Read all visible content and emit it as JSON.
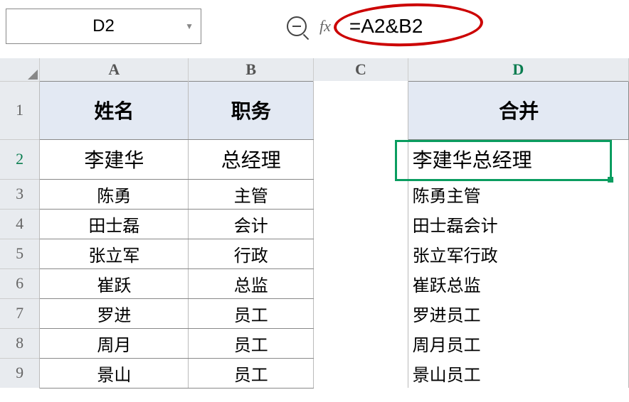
{
  "name_box": {
    "value": "D2"
  },
  "formula_bar": {
    "fx": "fx",
    "value": "=A2&B2"
  },
  "columns": [
    "A",
    "B",
    "C",
    "D"
  ],
  "headers": {
    "a": "姓名",
    "b": "职务",
    "c": "",
    "d": "合并"
  },
  "rows": [
    {
      "n": "1"
    },
    {
      "n": "2",
      "a": "李建华",
      "b": "总经理",
      "c": "",
      "d": "李建华总经理"
    },
    {
      "n": "3",
      "a": "陈勇",
      "b": "主管",
      "c": "",
      "d": "陈勇主管"
    },
    {
      "n": "4",
      "a": "田士磊",
      "b": "会计",
      "c": "",
      "d": "田士磊会计"
    },
    {
      "n": "5",
      "a": "张立军",
      "b": "行政",
      "c": "",
      "d": "张立军行政"
    },
    {
      "n": "6",
      "a": "崔跃",
      "b": "总监",
      "c": "",
      "d": "崔跃总监"
    },
    {
      "n": "7",
      "a": "罗进",
      "b": "员工",
      "c": "",
      "d": "罗进员工"
    },
    {
      "n": "8",
      "a": "周月",
      "b": "员工",
      "c": "",
      "d": "周月员工"
    },
    {
      "n": "9",
      "a": "景山",
      "b": "员工",
      "c": "",
      "d": "景山员工"
    }
  ],
  "chart_data": {
    "type": "table",
    "title": "",
    "columns": [
      "姓名",
      "职务",
      "合并"
    ],
    "rows": [
      [
        "李建华",
        "总经理",
        "李建华总经理"
      ],
      [
        "陈勇",
        "主管",
        "陈勇主管"
      ],
      [
        "田士磊",
        "会计",
        "田士磊会计"
      ],
      [
        "张立军",
        "行政",
        "张立军行政"
      ],
      [
        "崔跃",
        "总监",
        "崔跃总监"
      ],
      [
        "罗进",
        "员工",
        "罗进员工"
      ],
      [
        "周月",
        "员工",
        "周月员工"
      ],
      [
        "景山",
        "员工",
        "景山员工"
      ]
    ]
  }
}
